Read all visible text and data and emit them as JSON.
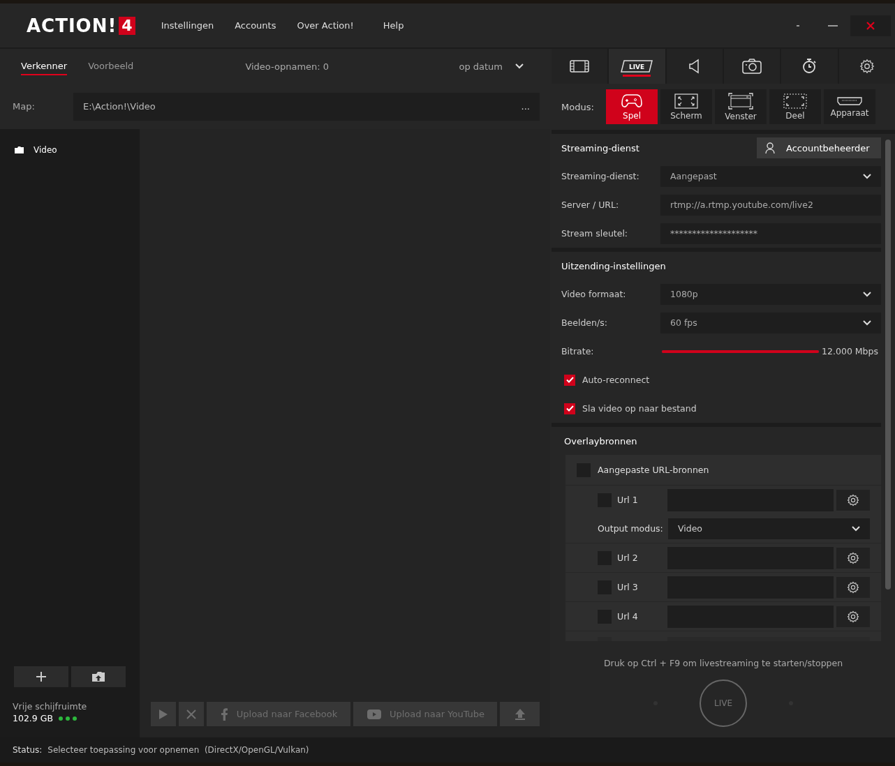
{
  "app": {
    "logo_text": "ACTION!",
    "logo_badge": "4"
  },
  "menu": [
    "Instellingen",
    "Accounts",
    "Over Action!",
    "Help"
  ],
  "explorer": {
    "tabs": [
      {
        "label": "Verkenner",
        "selected": true
      },
      {
        "label": "Voorbeeld",
        "selected": false
      }
    ],
    "count": "Video-opnamen: 0",
    "sort": "op datum",
    "folder": {
      "label": "Map:",
      "value": "E:\\Action!\\Video",
      "more": "..."
    },
    "tree": [
      {
        "label": "Video"
      }
    ],
    "free_space": {
      "label": "Vrije schijfruimte",
      "value": "102.9 GB"
    },
    "actions": [
      {
        "kind": "play",
        "disabled": true
      },
      {
        "kind": "delete",
        "disabled": true
      },
      {
        "kind": "facebook",
        "label": "Upload naar Facebook",
        "disabled": true
      },
      {
        "kind": "youtube",
        "label": "Upload naar YouTube",
        "disabled": true
      },
      {
        "kind": "upload",
        "disabled": true
      }
    ]
  },
  "panel_tabs": [
    {
      "kind": "film",
      "selected": false
    },
    {
      "kind": "live",
      "label": "LIVE",
      "selected": true
    },
    {
      "kind": "audio",
      "selected": false
    },
    {
      "kind": "camera",
      "selected": false
    },
    {
      "kind": "timer",
      "selected": false
    },
    {
      "kind": "settings",
      "selected": false
    }
  ],
  "modes": {
    "label": "Modus:",
    "items": [
      {
        "kind": "game",
        "label": "Spel",
        "selected": true
      },
      {
        "kind": "screen",
        "label": "Scherm",
        "selected": false
      },
      {
        "kind": "window",
        "label": "Venster",
        "selected": false
      },
      {
        "kind": "region",
        "label": "Deel",
        "selected": false
      },
      {
        "kind": "device",
        "label": "Apparaat",
        "selected": false
      }
    ]
  },
  "streaming": {
    "title": "Streaming-dienst",
    "account_button": "Accountbeheerder",
    "fields": [
      {
        "kind": "select",
        "label": "Streaming-dienst:",
        "value": "Aangepast"
      },
      {
        "kind": "text",
        "label": "Server / URL:",
        "value": "rtmp://a.rtmp.youtube.com/live2"
      },
      {
        "kind": "text",
        "label": "Stream sleutel:",
        "value": "********************"
      }
    ]
  },
  "broadcast": {
    "title": "Uitzending-instellingen",
    "fields": [
      {
        "kind": "select",
        "label": "Video formaat:",
        "value": "1080p"
      },
      {
        "kind": "select",
        "label": "Beelden/s:",
        "value": "60 fps"
      },
      {
        "kind": "slider",
        "label": "Bitrate:",
        "level": 1,
        "reading": "12.000 Mbps"
      }
    ],
    "options": [
      {
        "label": "Auto-reconnect",
        "checked": true
      },
      {
        "label": "Sla video op naar bestand",
        "checked": true
      }
    ]
  },
  "overlays": {
    "title": "Overlaybronnen",
    "group": {
      "label": "Aangepaste URL-bronnen",
      "checked": false
    },
    "urls": [
      {
        "label": "Url 1",
        "checked": false,
        "output": {
          "label": "Output modus:",
          "value": "Video"
        }
      },
      {
        "label": "Url 2",
        "checked": false
      },
      {
        "label": "Url 3",
        "checked": false
      },
      {
        "label": "Url 4",
        "checked": false
      }
    ]
  },
  "live": {
    "hint": "Druk op Ctrl + F9 om livestreaming te starten/stoppen",
    "button": "LIVE"
  },
  "status": {
    "label": "Status:",
    "text": "Selecteer toepassing voor opnemen  (DirectX/OpenGL/Vulkan)"
  }
}
